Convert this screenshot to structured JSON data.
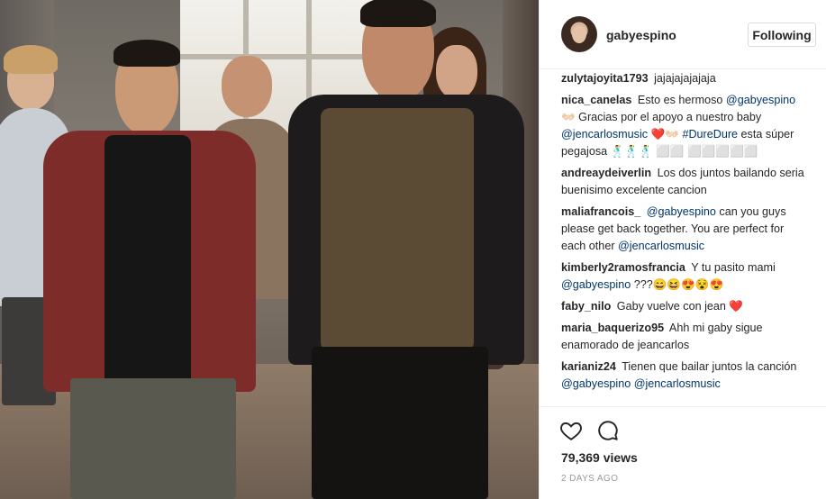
{
  "post": {
    "username": "gabyespino",
    "follow_label": "Following"
  },
  "comments": [
    {
      "user": "zulytajoyita1793",
      "parts": [
        {
          "t": "text",
          "v": "jajajajajajaja"
        }
      ]
    },
    {
      "user": "nica_canelas",
      "parts": [
        {
          "t": "text",
          "v": "Esto es hermoso "
        },
        {
          "t": "mention",
          "v": "@gabyespino"
        },
        {
          "t": "text",
          "v": " 👐🏻 Gracias por el apoyo a nuestro baby "
        },
        {
          "t": "mention",
          "v": "@jencarlosmusic"
        },
        {
          "t": "text",
          "v": " ❤️👐🏻 "
        },
        {
          "t": "mention",
          "v": "#DureDure"
        },
        {
          "t": "text",
          "v": " esta súper pegajosa 🕺🕺🕺 ⬜⬜ ⬜⬜⬜⬜⬜"
        }
      ]
    },
    {
      "user": "andreaydeiverlin",
      "parts": [
        {
          "t": "text",
          "v": "Los dos juntos bailando seria buenisimo excelente cancion"
        }
      ]
    },
    {
      "user": "maliafrancois_",
      "parts": [
        {
          "t": "mention",
          "v": "@gabyespino"
        },
        {
          "t": "text",
          "v": " can you guys please get back together. You are perfect for each other "
        },
        {
          "t": "mention",
          "v": "@jencarlosmusic"
        }
      ]
    },
    {
      "user": "kimberly2ramosfrancia",
      "parts": [
        {
          "t": "text",
          "v": "Y tu pasito mami "
        },
        {
          "t": "mention",
          "v": "@gabyespino"
        },
        {
          "t": "text",
          "v": " ???😄😆😍😵😍"
        }
      ]
    },
    {
      "user": "faby_nilo",
      "parts": [
        {
          "t": "text",
          "v": "Gaby vuelve con jean ❤️"
        }
      ]
    },
    {
      "user": "maria_baquerizo95",
      "parts": [
        {
          "t": "text",
          "v": "Ahh mi gaby sigue enamorado de jeancarlos"
        }
      ]
    },
    {
      "user": "karianiz24",
      "parts": [
        {
          "t": "text",
          "v": "Tienen que bailar juntos la canción "
        },
        {
          "t": "mention",
          "v": "@gabyespino"
        },
        {
          "t": "text",
          "v": " "
        },
        {
          "t": "mention",
          "v": "@jencarlosmusic"
        }
      ]
    }
  ],
  "actions": {
    "like_icon": "heart-icon",
    "comment_icon": "comment-bubble-icon"
  },
  "stats": {
    "views": "79,369 views",
    "timestamp": "2 DAYS AGO"
  },
  "colors": {
    "link": "#003569",
    "text": "#262626",
    "muted": "#999999",
    "border": "#efefef"
  }
}
